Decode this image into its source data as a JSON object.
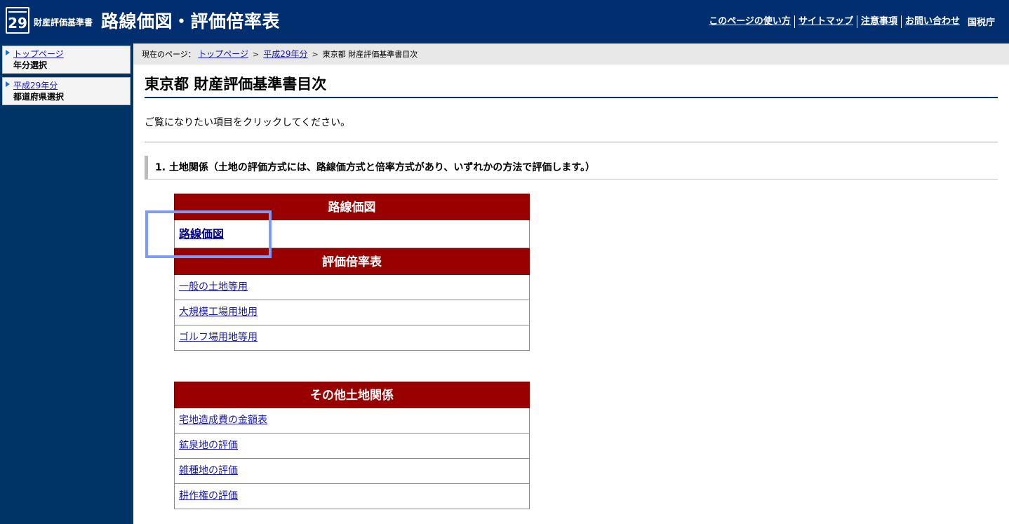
{
  "header": {
    "logo_number": "29",
    "site_small": "財産評価基準書",
    "site_big": "路線価図・評価倍率表",
    "nav": [
      "このページの使い方",
      "サイトマップ",
      "注意事項",
      "お問い合わせ"
    ],
    "agency": "国税庁"
  },
  "sidebar": {
    "items": [
      {
        "link": "トップページ",
        "sub": "年分選択"
      },
      {
        "link": "平成29年分",
        "sub": "都道府県選択"
      }
    ]
  },
  "breadcrumb": {
    "prefix": "現在のページ：",
    "links": [
      "トップページ",
      "平成29年分"
    ],
    "current": "東京都 財産評価基準書目次",
    "separator": ">"
  },
  "main": {
    "title": "東京都 財産評価基準書目次",
    "intro": "ご覧になりたい項目をクリックしてください。",
    "section1": "1. 土地関係（土地の評価方式には、路線価方式と倍率方式があり、いずれかの方法で評価します。）"
  },
  "tables": {
    "rosenka": {
      "head": "路線価図",
      "rows": [
        "路線価図"
      ]
    },
    "bairitsu": {
      "head": "評価倍率表",
      "rows": [
        "一般の土地等用",
        "大規模工場用地用",
        "ゴルフ場用地等用"
      ]
    },
    "sonota": {
      "head": "その他土地関係",
      "rows": [
        "宅地造成費の金額表",
        "鉱泉地の評価",
        "雑種地の評価",
        "耕作権の評価"
      ]
    }
  },
  "colors": {
    "header_bg": "#002e6e",
    "table_head": "#990000",
    "link": "#1a1aa6",
    "highlight": "#7f9cf5"
  }
}
